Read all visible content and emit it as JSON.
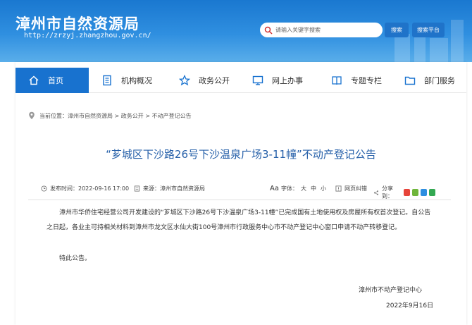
{
  "header": {
    "site_title": "漳州市自然资源局",
    "site_url": "http://zrzyj.zhangzhou.gov.cn/",
    "search_placeholder": "请输入关键字搜索",
    "search_button": "搜索",
    "platform_button": "搜索平台"
  },
  "nav": {
    "items": [
      {
        "label": "首页",
        "icon": "home-icon"
      },
      {
        "label": "机构概况",
        "icon": "document-icon"
      },
      {
        "label": "政务公开",
        "icon": "star-icon"
      },
      {
        "label": "网上办事",
        "icon": "monitor-icon"
      },
      {
        "label": "专题专栏",
        "icon": "book-icon"
      },
      {
        "label": "部门服务",
        "icon": "folder-icon"
      }
    ]
  },
  "breadcrumb": {
    "prefix": "当前位置：",
    "path": "漳州市自然资源局 > 政务公开 > 不动产登记公告"
  },
  "article": {
    "title": "“芗城区下沙路26号下沙温泉广场3-11幢”不动产登记公告",
    "publish_label": "发布时间：",
    "publish_time": "2022-09-16 17:00",
    "source_label": "来源：",
    "source": "漳州市自然资源局",
    "font_aa": "Aa",
    "font_label": "字体：",
    "font_large": "大",
    "font_medium": "中",
    "font_small": "小",
    "report": "网页纠错",
    "share_label": "分享到：",
    "body": "漳州市华侨住宅经营公司开发建设的“芗城区下沙路26号下沙温泉广场3-11幢”已完成国有土地使用权及房屋所有权首次登记。自公告之日起，各业主可持相关材料到漳州市龙文区水仙大街100号漳州市行政服务中心市不动产登记中心窗口申请不动产转移登记。",
    "closing": "特此公告。",
    "signature_org": "漳州市不动产登记中心",
    "signature_date": "2022年9月16日"
  },
  "colors": {
    "banner_blue": "#1a78d0",
    "nav_active": "#1872cf",
    "title_blue": "#2660a9"
  }
}
